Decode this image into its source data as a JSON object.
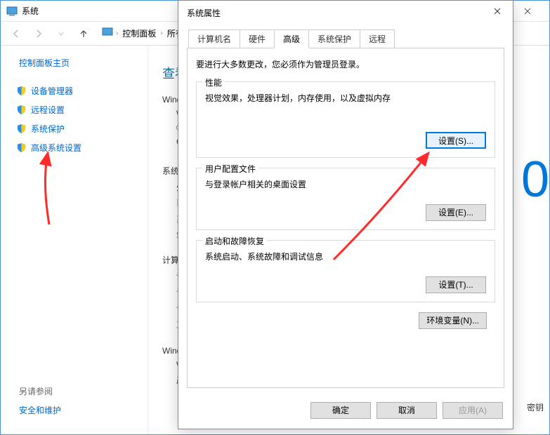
{
  "explorer": {
    "title": "系统",
    "breadcrumbs": [
      "控制面板",
      "所有"
    ],
    "sidebar_home": "控制面板主页",
    "sidebar_items": [
      {
        "label": "设备管理器"
      },
      {
        "label": "远程设置"
      },
      {
        "label": "系统保护"
      },
      {
        "label": "高级系统设置"
      }
    ],
    "see_also_label": "另请参阅",
    "see_also_link": "安全和维护",
    "main_heading": "查看",
    "section1": "Wind",
    "section1_sub1": "W",
    "section1_sub2": "©",
    "section1_sub3": "C",
    "section2": "系统",
    "section2_subs": [
      "处",
      "已",
      "系",
      "笔"
    ],
    "section3": "计算",
    "section3_subs": [
      "计",
      "计",
      "计",
      "工"
    ],
    "section4": "Wind",
    "section4_subs": [
      "W",
      "产"
    ],
    "big_zero": "0",
    "activation_key": "密钥"
  },
  "dialog": {
    "title": "系统属性",
    "tabs": [
      "计算机名",
      "硬件",
      "高级",
      "系统保护",
      "远程"
    ],
    "active_tab": 2,
    "admin_note": "要进行大多数更改，您必须作为管理员登录。",
    "groups": [
      {
        "legend": "性能",
        "desc": "视觉效果，处理器计划，内存使用，以及虚拟内存",
        "button": "设置(S)..."
      },
      {
        "legend": "用户配置文件",
        "desc": "与登录帐户相关的桌面设置",
        "button": "设置(E)..."
      },
      {
        "legend": "启动和故障恢复",
        "desc": "系统启动、系统故障和调试信息",
        "button": "设置(T)..."
      }
    ],
    "env_button": "环境变量(N)...",
    "footer": {
      "ok": "确定",
      "cancel": "取消",
      "apply": "应用(A)"
    }
  }
}
